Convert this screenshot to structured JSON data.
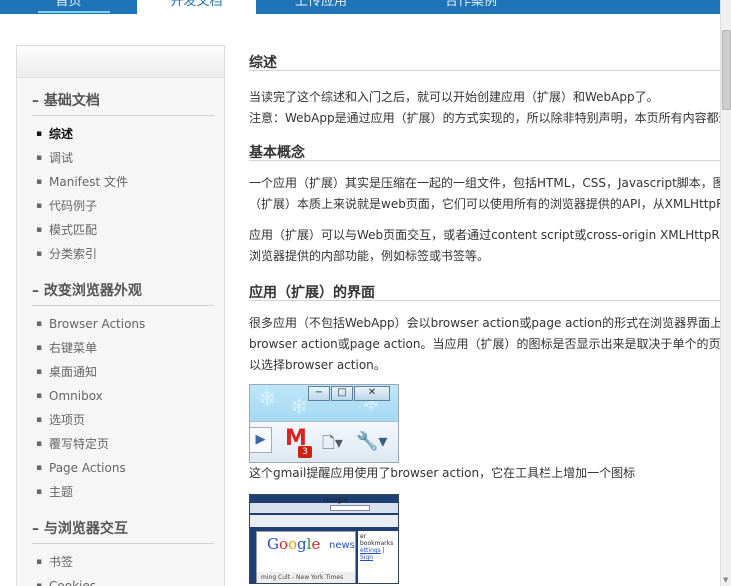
{
  "nav": {
    "tabs": [
      {
        "label": "首页"
      },
      {
        "label": "开发文档"
      },
      {
        "label": "上传应用"
      },
      {
        "label": "合作案例"
      }
    ]
  },
  "sidebar": {
    "groups": [
      {
        "title": "– 基础文档",
        "items": [
          "综述",
          "调试",
          "Manifest 文件",
          "代码例子",
          "模式匹配",
          "分类索引"
        ]
      },
      {
        "title": "– 改变浏览器外观",
        "items": [
          "Browser Actions",
          "右键菜单",
          "桌面通知",
          "Omnibox",
          "选项页",
          "覆写特定页",
          "Page Actions",
          "主题"
        ]
      },
      {
        "title": "– 与浏览器交互",
        "items": [
          "书签",
          "Cookies"
        ]
      }
    ]
  },
  "content": {
    "sec1": {
      "title": "综述",
      "p1": "当读完了这个综述和入门之后，就可以开始创建应用（扩展）和WebApp了。",
      "p2": "注意：WebApp是通过应用（扩展）的方式实现的，所以除非特别声明，本页所有内容都适"
    },
    "sec2": {
      "title": "基本概念",
      "p1a": "一个应用（扩展）其实是压缩在一起的一组文件，包括HTML，CSS，Javascript脚本，图片",
      "p1b": "（扩展）本质上来说就是web页面，它们可以使用所有的浏览器提供的API，从XMLHttpReq",
      "p2a": "应用（扩展）可以与Web页面交互，或者通过content script或cross-origin XMLHttpReque",
      "p2b": "浏览器提供的内部功能，例如标签或书签等。"
    },
    "sec3": {
      "title": "应用（扩展）的界面",
      "p1a": "很多应用（不包括WebApp）会以browser action或page action的形式在浏览器界面上展现",
      "p1b": "browser action或page action。当应用（扩展）的图标是否显示出来是取决于单个的页面时",
      "p1c": "以选择browser action。"
    },
    "shot1": {
      "badge": "3",
      "win_min": "−",
      "win_max": "□",
      "win_close": "✕"
    },
    "caption1": "这个gmail提醒应用使用了browser action，它在工具栏上增加一个图标",
    "shot2": {
      "google_small": "Google",
      "logo": [
        "G",
        "o",
        "o",
        "g",
        "l",
        "e"
      ],
      "news": "news",
      "side1": "er bookmarks",
      "side2": "ettings",
      "side3": "Sign",
      "strip": "ming Cult - New York Times"
    }
  }
}
